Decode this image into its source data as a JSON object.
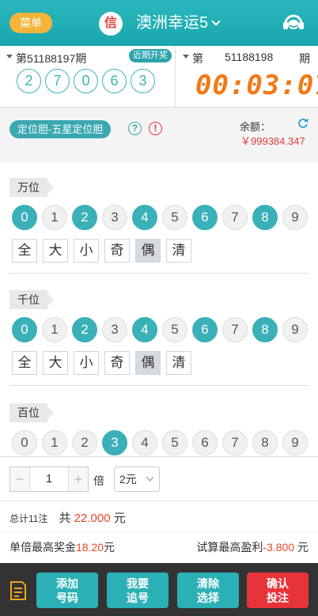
{
  "header": {
    "menu_label": "菜单",
    "credit_badge": "信",
    "lottery_title": "澳洲幸运5",
    "service_icon": "headset-icon"
  },
  "draw": {
    "prev_period_label": "第51188197期",
    "recent_label": "近期开奖",
    "prev_numbers": [
      "2",
      "7",
      "0",
      "6",
      "3"
    ],
    "current_di": "第",
    "current_period": "51188198",
    "current_qi": "期",
    "countdown": "00:03:07"
  },
  "play": {
    "mode_label": "定位胆-五星定位胆",
    "help_icon": "?",
    "warn_icon": "!",
    "balance_label": "余额：",
    "balance_value": "￥999384.347"
  },
  "positions": [
    {
      "name": "万位",
      "digits": [
        "0",
        "1",
        "2",
        "3",
        "4",
        "5",
        "6",
        "7",
        "8",
        "9"
      ],
      "selected": [
        true,
        false,
        true,
        false,
        true,
        false,
        true,
        false,
        true,
        false
      ],
      "filters": [
        "全",
        "大",
        "小",
        "奇",
        "偶",
        "清"
      ],
      "filter_active": [
        false,
        false,
        false,
        false,
        true,
        false
      ]
    },
    {
      "name": "千位",
      "digits": [
        "0",
        "1",
        "2",
        "3",
        "4",
        "5",
        "6",
        "7",
        "8",
        "9"
      ],
      "selected": [
        true,
        false,
        true,
        false,
        true,
        false,
        true,
        false,
        true,
        false
      ],
      "filters": [
        "全",
        "大",
        "小",
        "奇",
        "偶",
        "清"
      ],
      "filter_active": [
        false,
        false,
        false,
        false,
        true,
        false
      ]
    },
    {
      "name": "百位",
      "digits": [
        "0",
        "1",
        "2",
        "3",
        "4",
        "5",
        "6",
        "7",
        "8",
        "9"
      ],
      "selected": [
        false,
        false,
        false,
        true,
        false,
        false,
        false,
        false,
        false,
        false
      ],
      "filters": [
        "全",
        "大",
        "小",
        "奇",
        "偶",
        "清"
      ],
      "filter_active": [
        false,
        false,
        false,
        false,
        false,
        false
      ]
    }
  ],
  "bet": {
    "minus": "−",
    "multiple": "1",
    "plus": "+",
    "bei_label": "倍",
    "unit": "2元",
    "total_label": "总计11注",
    "gong": "共",
    "amount": "22.000",
    "yuan": "元",
    "max_prize_label": "单倍最高奖金",
    "max_prize": "18.20",
    "max_profit_label": "试算最高盈利",
    "max_profit": "-3.800"
  },
  "actions": {
    "add_number": "添加\n号码",
    "chase": "我要\n追号",
    "clear": "清除\n选择",
    "confirm": "确认\n投注"
  },
  "colors": {
    "teal": "#2bb1b5",
    "orange": "#f07a17",
    "red": "#e6462a"
  }
}
